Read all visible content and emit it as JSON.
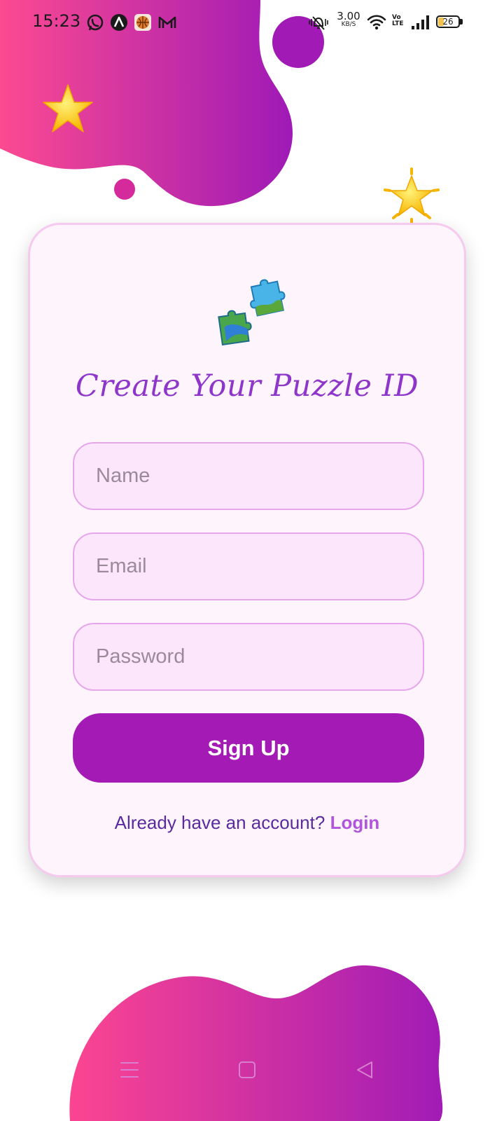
{
  "status_bar": {
    "time": "15:23",
    "net_speed_value": "3.00",
    "net_speed_unit": "KB/S",
    "volte_line1": "Vo",
    "volte_line2": "LTE",
    "battery_level": "26",
    "notification_icons": [
      "whatsapp-icon",
      "arc-a-icon",
      "basketball-app-icon",
      "gmail-icon"
    ],
    "system_icons": [
      "bell-off-icon",
      "wifi-icon",
      "signal-icon",
      "battery-icon"
    ]
  },
  "signup_card": {
    "logo_icon": "puzzle-pieces-icon",
    "title": "Create Your Puzzle ID",
    "fields": {
      "name_placeholder": "Name",
      "email_placeholder": "Email",
      "password_placeholder": "Password"
    },
    "signup_label": "Sign Up",
    "login_prompt": "Already have an account?",
    "login_link": "Login"
  },
  "decorations": [
    "star-icon",
    "glowing-star-icon"
  ],
  "nav_bar": [
    "menu-icon",
    "home-square-icon",
    "back-triangle-icon"
  ],
  "colors": {
    "gradient_start": "#fc4a91",
    "gradient_end": "#9e1ab6",
    "button": "#a31bb4",
    "title": "#8e36c9",
    "field_bg": "#fce6fb",
    "field_border": "#e7a6ec",
    "login_link": "#b055dc"
  }
}
